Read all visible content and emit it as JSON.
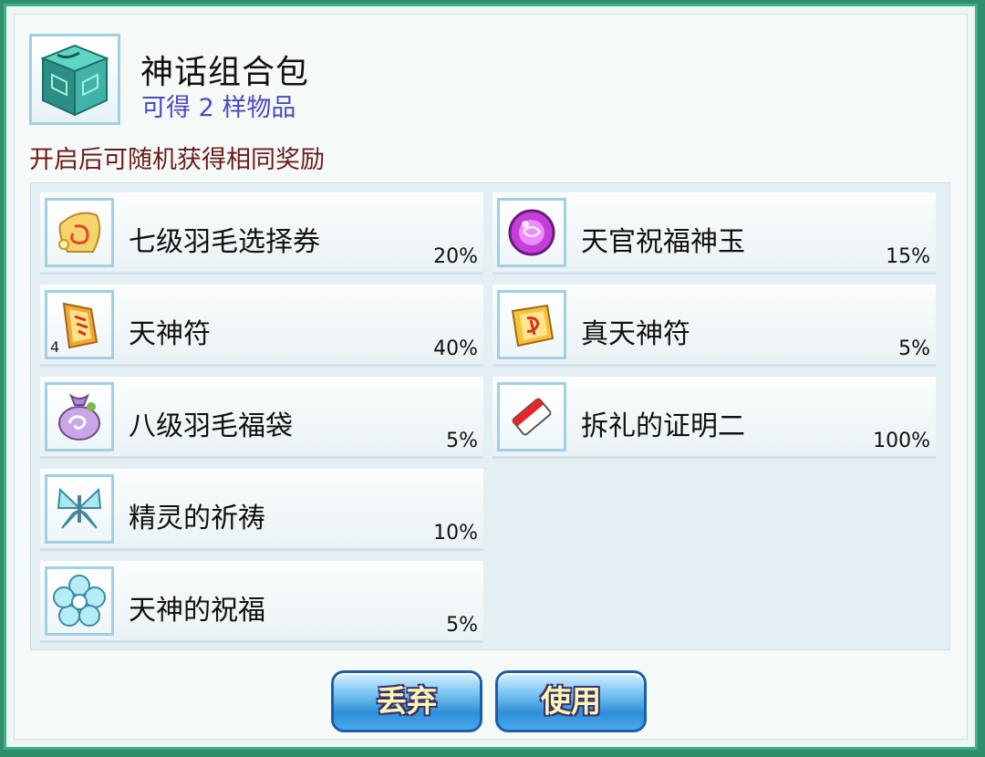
{
  "header": {
    "title": "神话组合包",
    "subtitle": "可得 2 样物品",
    "icon": "jade-gift-box-icon"
  },
  "description": "开启后可随机获得相同奖励",
  "items": [
    {
      "name": "七级羽毛选择券",
      "pct": "20%",
      "count": "",
      "icon": "feather-ticket-icon"
    },
    {
      "name": "天官祝福神玉",
      "pct": "15%",
      "count": "",
      "icon": "purple-jade-orb-icon"
    },
    {
      "name": "天神符",
      "pct": "40%",
      "count": "4",
      "icon": "talisman-scroll-icon"
    },
    {
      "name": "真天神符",
      "pct": "5%",
      "count": "",
      "icon": "true-talisman-icon"
    },
    {
      "name": "八级羽毛福袋",
      "pct": "5%",
      "count": "",
      "icon": "lucky-bag-icon"
    },
    {
      "name": "拆礼的证明二",
      "pct": "100%",
      "count": "",
      "icon": "red-white-ticket-icon"
    },
    {
      "name": "精灵的祈祷",
      "pct": "10%",
      "count": "",
      "icon": "crystal-butterfly-icon"
    },
    {
      "name": "天神的祝福",
      "pct": "5%",
      "count": "",
      "icon": "crystal-flower-icon"
    }
  ],
  "buttons": {
    "discard": "丢弃",
    "use": "使用"
  },
  "colors": {
    "frame": "#3bb08a",
    "subtitle": "#4a4ac0",
    "description": "#6a1c1c",
    "button_text": "#fff6b0"
  }
}
